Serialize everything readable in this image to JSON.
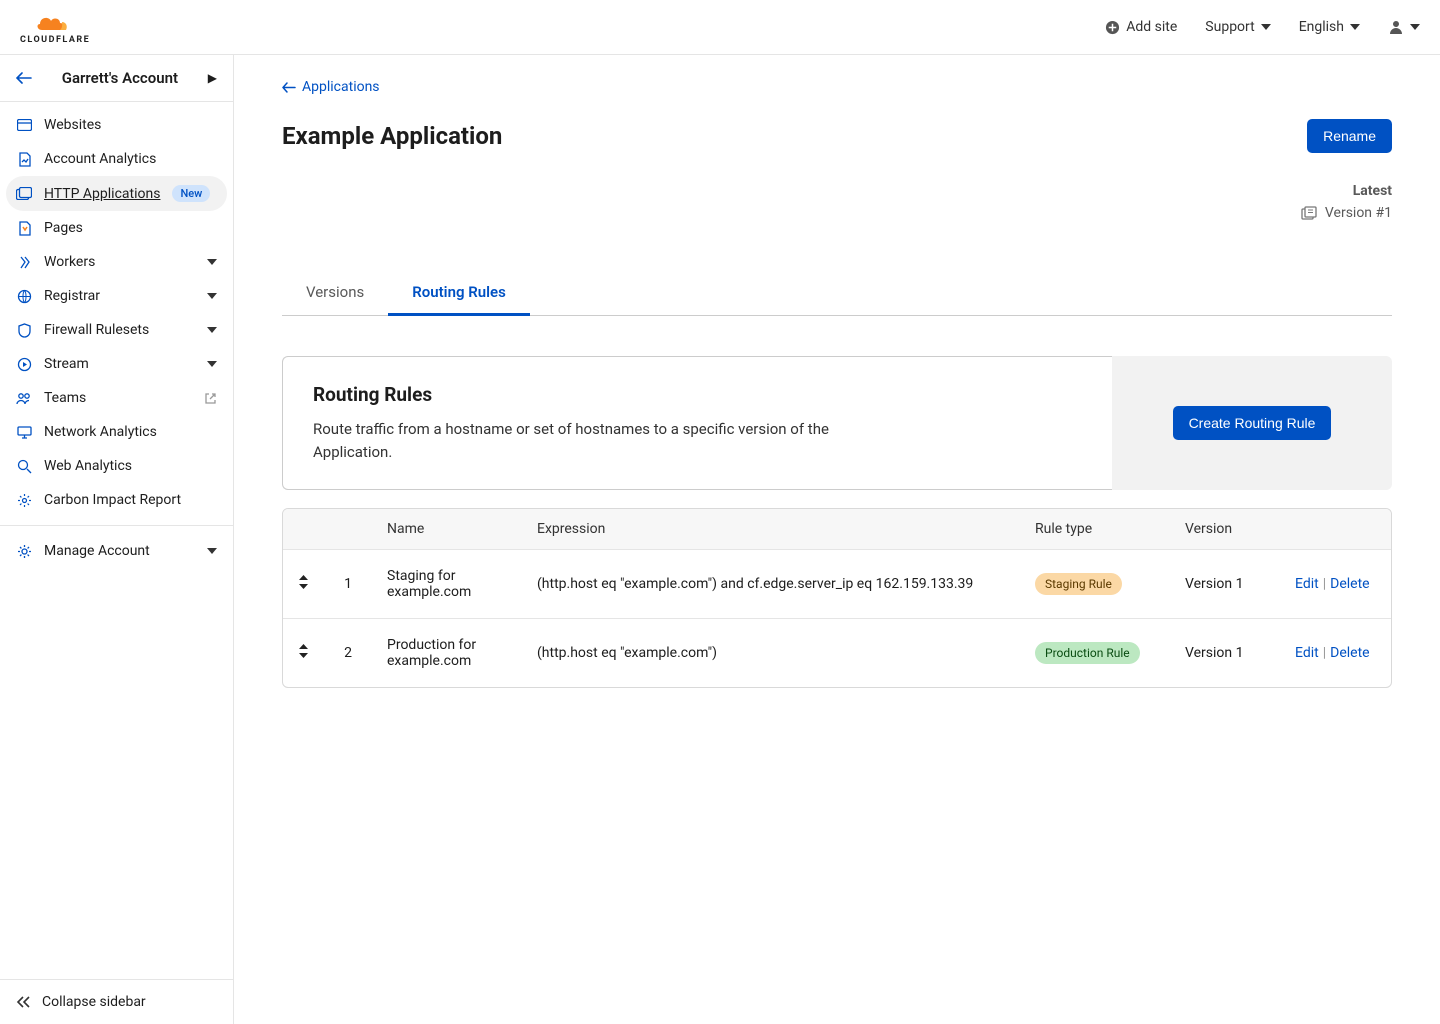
{
  "topbar": {
    "add_site": "Add site",
    "support": "Support",
    "language": "English"
  },
  "account": {
    "name": "Garrett's Account"
  },
  "sidebar": {
    "items": [
      {
        "label": "Websites"
      },
      {
        "label": "Account Analytics"
      },
      {
        "label": "HTTP Applications",
        "badge": "New"
      },
      {
        "label": "Pages"
      },
      {
        "label": "Workers"
      },
      {
        "label": "Registrar"
      },
      {
        "label": "Firewall Rulesets"
      },
      {
        "label": "Stream"
      },
      {
        "label": "Teams"
      },
      {
        "label": "Network Analytics"
      },
      {
        "label": "Web Analytics"
      },
      {
        "label": "Carbon Impact Report"
      }
    ],
    "manage": "Manage Account",
    "collapse": "Collapse sidebar"
  },
  "breadcrumb": {
    "back_label": "Applications"
  },
  "page": {
    "title": "Example Application",
    "rename": "Rename",
    "latest_label": "Latest",
    "version_label": "Version #1"
  },
  "tabs": {
    "versions": "Versions",
    "routing": "Routing Rules"
  },
  "panel": {
    "title": "Routing Rules",
    "desc": "Route traffic from a hostname or set of hostnames to a specific version of the Application.",
    "create": "Create Routing Rule"
  },
  "table": {
    "headers": {
      "name": "Name",
      "expression": "Expression",
      "rule_type": "Rule type",
      "version": "Version"
    },
    "rows": [
      {
        "order": "1",
        "name": "Staging for example.com",
        "expression": "(http.host eq \"example.com\") and cf.edge.server_ip eq 162.159.133.39",
        "rule_type": "Staging Rule",
        "rule_class": "staging",
        "version": "Version 1"
      },
      {
        "order": "2",
        "name": "Production for example.com",
        "expression": "(http.host eq \"example.com\")",
        "rule_type": "Production Rule",
        "rule_class": "production",
        "version": "Version 1"
      }
    ],
    "actions": {
      "edit": "Edit",
      "delete": "Delete"
    }
  }
}
